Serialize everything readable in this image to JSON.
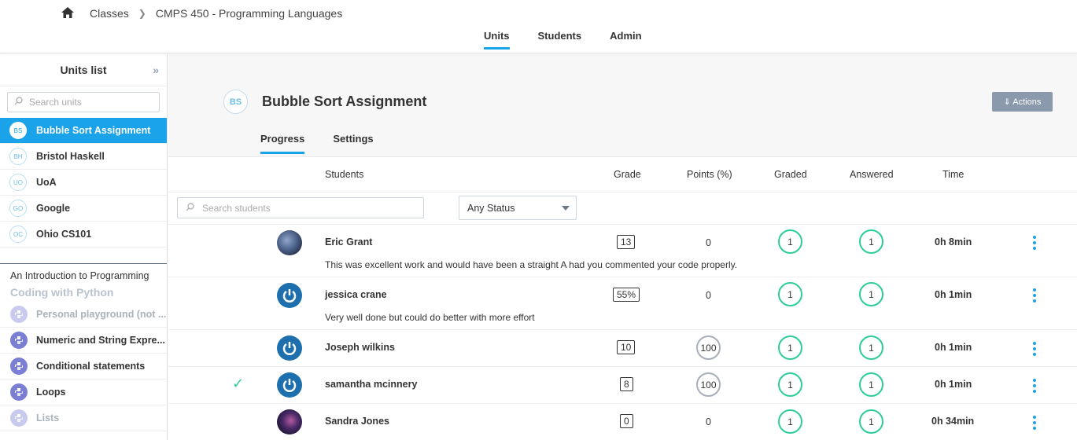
{
  "breadcrumb": {
    "home_icon": "home-icon",
    "items": [
      "Classes",
      "CMPS 450 - Programming Languages"
    ]
  },
  "topnav": {
    "tabs": [
      "Units",
      "Students",
      "Admin"
    ],
    "active": "Units"
  },
  "sidebar": {
    "title": "Units list",
    "collapse_glyph": "»",
    "search_placeholder": "Search units",
    "units": [
      {
        "badge": "BS",
        "label": "Bubble Sort Assignment",
        "active": true
      },
      {
        "badge": "BH",
        "label": "Bristol Haskell"
      },
      {
        "badge": "UO",
        "label": "UoA"
      },
      {
        "badge": "GO",
        "label": "Google"
      },
      {
        "badge": "OC",
        "label": "Ohio CS101"
      }
    ],
    "course_title": "An Introduction to Programming",
    "course_sub": "Coding with Python",
    "lessons": [
      {
        "label": "Personal playground (not ...",
        "dim": true
      },
      {
        "label": "Numeric and String Expre..."
      },
      {
        "label": "Conditional statements"
      },
      {
        "label": "Loops"
      },
      {
        "label": "Lists",
        "dim": true
      }
    ]
  },
  "assignment": {
    "badge": "BS",
    "title": "Bubble Sort Assignment",
    "actions_label": "⇓ Actions",
    "tabs": [
      "Progress",
      "Settings"
    ],
    "active_tab": "Progress"
  },
  "table": {
    "columns": [
      "Students",
      "Grade",
      "Points (%)",
      "Graded",
      "Answered",
      "Time"
    ],
    "search_placeholder": "Search students",
    "status_filter": "Any Status",
    "rows": [
      {
        "name": "Eric Grant",
        "grade": "13",
        "points": "0",
        "graded": "1",
        "answered": "1",
        "time": "0h 8min",
        "comment": "This was excellent work and would have been a straight A had you commented your code properly.",
        "avatar": "earth"
      },
      {
        "name": "jessica crane",
        "grade": "55%",
        "points": "0",
        "graded": "1",
        "answered": "1",
        "time": "0h 1min",
        "comment": "Very well done but could do better with more effort",
        "avatar": "power"
      },
      {
        "name": "Joseph wilkins",
        "grade": "10",
        "points": "100",
        "graded": "1",
        "answered": "1",
        "time": "0h 1min",
        "avatar": "power"
      },
      {
        "name": "samantha mcinnery",
        "grade": "8",
        "points": "100",
        "graded": "1",
        "answered": "1",
        "time": "0h 1min",
        "avatar": "power",
        "checked": true
      },
      {
        "name": "Sandra Jones",
        "grade": "0",
        "points": "0",
        "graded": "1",
        "answered": "1",
        "time": "0h 34min",
        "avatar": "space"
      }
    ]
  },
  "colors": {
    "accent": "#1aa3e8",
    "green": "#2ecc9a",
    "actions_bg": "#8a99ab"
  }
}
